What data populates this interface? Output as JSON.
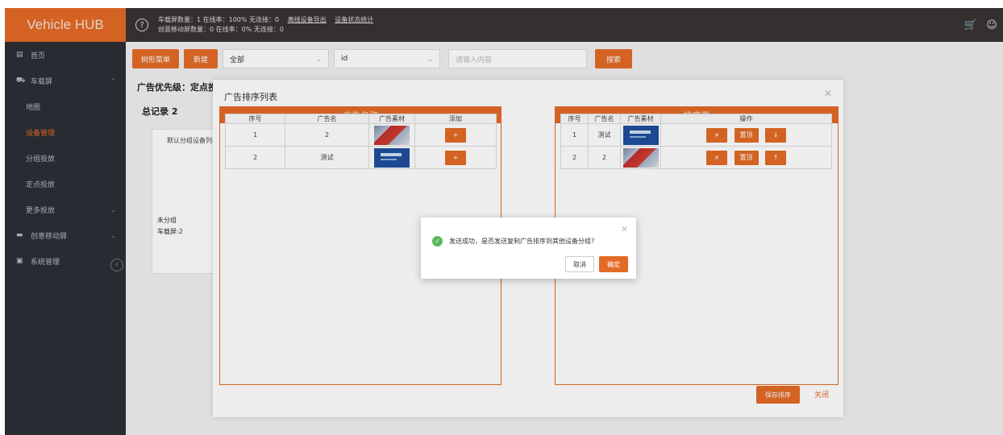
{
  "app": {
    "title": "Vehicle HUB",
    "help_icon": "question-circle-icon"
  },
  "stats": {
    "line1": "车载屏数量：1 在线率：100% 无连接：0",
    "line2": "创意移动屏数量：0 在线率：0% 无连接：0",
    "link_export": "离线设备导出",
    "link_stats": "设备状态统计"
  },
  "topbar_icons": [
    "cart-icon",
    "user-icon"
  ],
  "sidebar": {
    "items": [
      {
        "label": "首页",
        "icon": "dashboard-icon"
      },
      {
        "label": "车载屏",
        "icon": "car-icon"
      },
      {
        "label": "地图"
      },
      {
        "label": "设备管理",
        "active": true
      },
      {
        "label": "分组投放"
      },
      {
        "label": "定点投放"
      },
      {
        "label": "更多投放"
      },
      {
        "label": "创意移动屏",
        "icon": "screen-icon"
      },
      {
        "label": "系统管理",
        "icon": "settings-icon"
      }
    ]
  },
  "toolbar": {
    "tree_menu": "树形菜单",
    "new": "新建",
    "filter_all": "全部",
    "filter_field": "id",
    "search_placeholder": "请输入内容",
    "search": "搜索"
  },
  "main": {
    "priority_label": "广告优先级：定点投",
    "total_label": "总记录 2",
    "card_tab": "默认分组设备列表",
    "card_group": "未分组",
    "card_count": "车载屏:2"
  },
  "dialog": {
    "title": "广告排序列表",
    "left_panel": {
      "header": "广告名称",
      "columns": [
        "序号",
        "广告名",
        "广告素材",
        "添加"
      ],
      "rows": [
        {
          "index": "1",
          "name": "2",
          "thumb": "flag",
          "action": "+"
        },
        {
          "index": "2",
          "name": "测试",
          "thumb": "blue",
          "action": "+"
        }
      ]
    },
    "right_panel": {
      "header": "排序表",
      "columns": [
        "序号",
        "广告名",
        "广告素材",
        "操作"
      ],
      "rows": [
        {
          "index": "1",
          "name": "测试",
          "thumb": "blue",
          "del": "×",
          "top": "置顶",
          "move": "↓"
        },
        {
          "index": "2",
          "name": "2",
          "thumb": "flag",
          "del": "×",
          "top": "置顶",
          "move": "↑"
        }
      ]
    },
    "save": "保存排序",
    "close": "关闭"
  },
  "confirm": {
    "message": "发送成功，是否发送复制广告排序到其他设备分组?",
    "cancel": "取消",
    "ok": "确定"
  },
  "colors": {
    "accent": "#e36a26",
    "sidebar": "#2c2f36",
    "topbar": "#3a3434",
    "success": "#5cb85c"
  }
}
